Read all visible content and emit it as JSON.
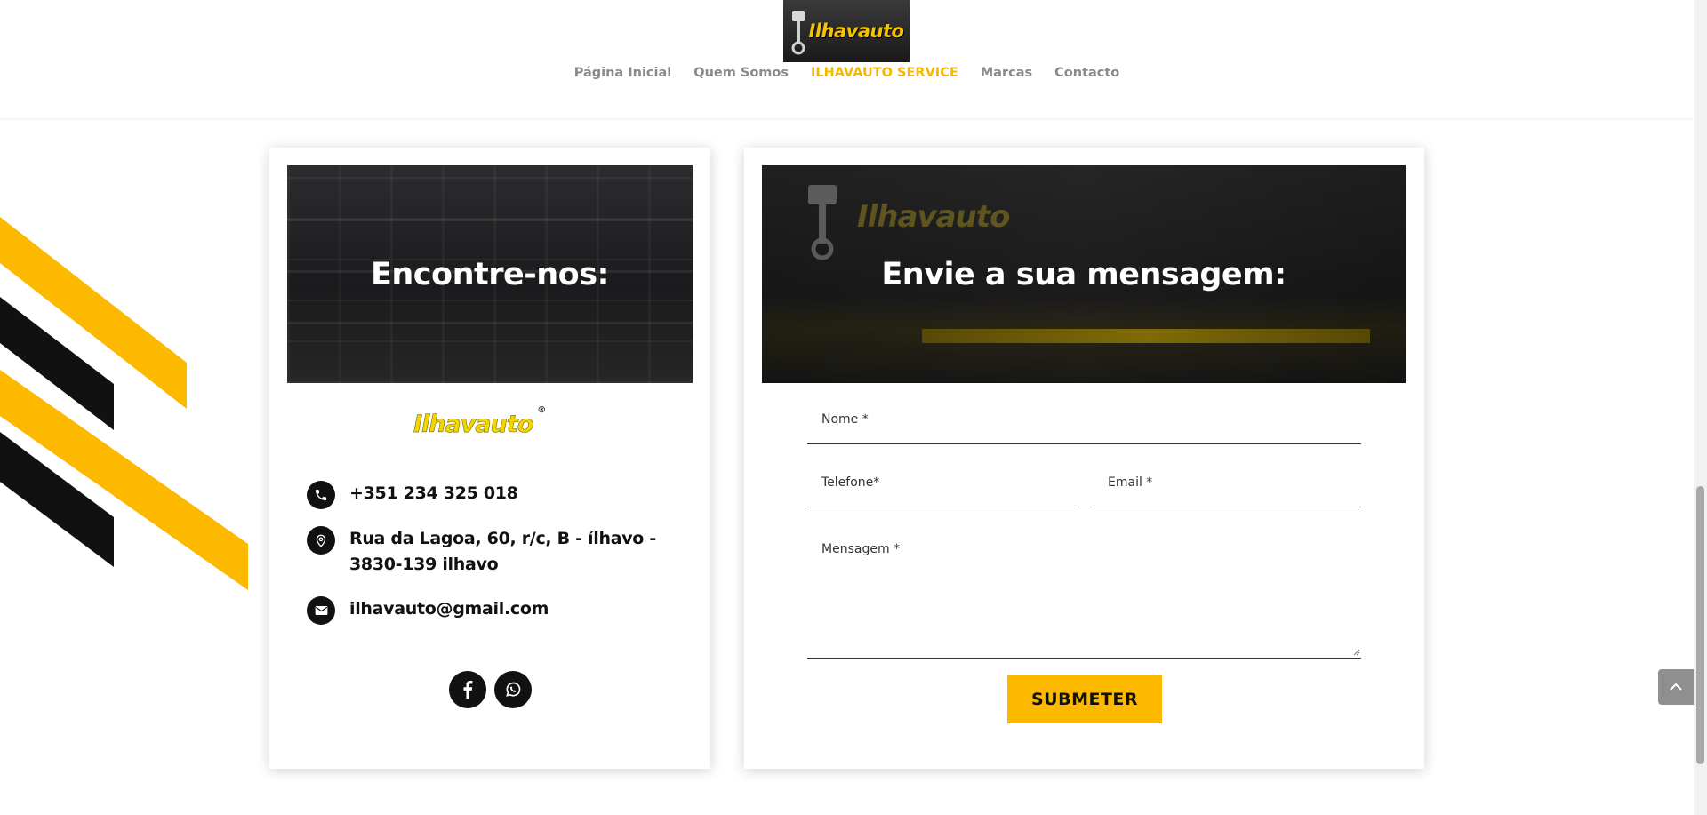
{
  "header": {
    "logo_text": "Ilhavauto",
    "nav": [
      {
        "label": "Página Inicial",
        "active": false
      },
      {
        "label": "Quem Somos",
        "active": false
      },
      {
        "label": "ILHAVAUTO SERVICE",
        "active": true
      },
      {
        "label": "Marcas",
        "active": false
      },
      {
        "label": "Contacto",
        "active": false
      }
    ]
  },
  "contact_card": {
    "title": "Encontre-nos:",
    "brand_logo": "Ilhavauto",
    "brand_reg": "®",
    "phone": "+351 234 325 018",
    "address": "Rua da Lagoa, 60, r/c, B - ílhavo - 3830-139 ilhavo",
    "email": "ilhavauto@gmail.com",
    "icons": [
      "phone-icon",
      "location-pin-icon",
      "mail-icon",
      "facebook-icon",
      "whatsapp-icon"
    ]
  },
  "form_card": {
    "title": "Envie a sua mensagem:",
    "banner_logo": "Ilhavauto",
    "fields": {
      "name_placeholder": "Nome *",
      "phone_placeholder": "Telefone*",
      "email_placeholder": "Email *",
      "message_placeholder": "Mensagem *"
    },
    "submit_label": "SUBMETER"
  },
  "colors": {
    "accent": "#fcb900",
    "nav_active": "#f5b800",
    "nav_inactive": "#8a8a8a",
    "dark": "#111111"
  }
}
